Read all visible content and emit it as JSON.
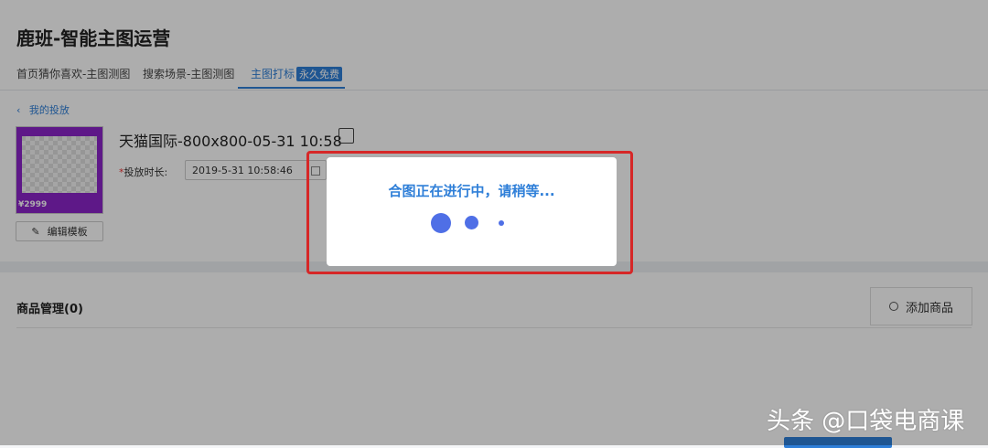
{
  "app": {
    "title": "鹿班-智能主图运营"
  },
  "tabs": [
    {
      "label": "首页猜你喜欢-主图测图"
    },
    {
      "label": "搜索场景-主图测图"
    },
    {
      "label": "主图打标",
      "badge": "永久免费"
    }
  ],
  "back": {
    "label": "我的投放"
  },
  "product": {
    "name": "天猫国际-800x800-05-31 10:58",
    "thumb_price": "¥2999"
  },
  "form": {
    "required_mark": "*",
    "duration_label": "投放时长:",
    "duration_value": "2019-5-31 10:58:46"
  },
  "edit_template": {
    "label": "编辑模板"
  },
  "goods": {
    "title": "商品管理(0)",
    "add_label": "添加商品"
  },
  "modal": {
    "message": "合图正在进行中，请稍等..."
  },
  "watermark": {
    "text": "头条 @口袋电商课"
  },
  "colors": {
    "accent": "#2f7fd8",
    "highlight": "#d62727",
    "dots": "#4f6fe6"
  }
}
